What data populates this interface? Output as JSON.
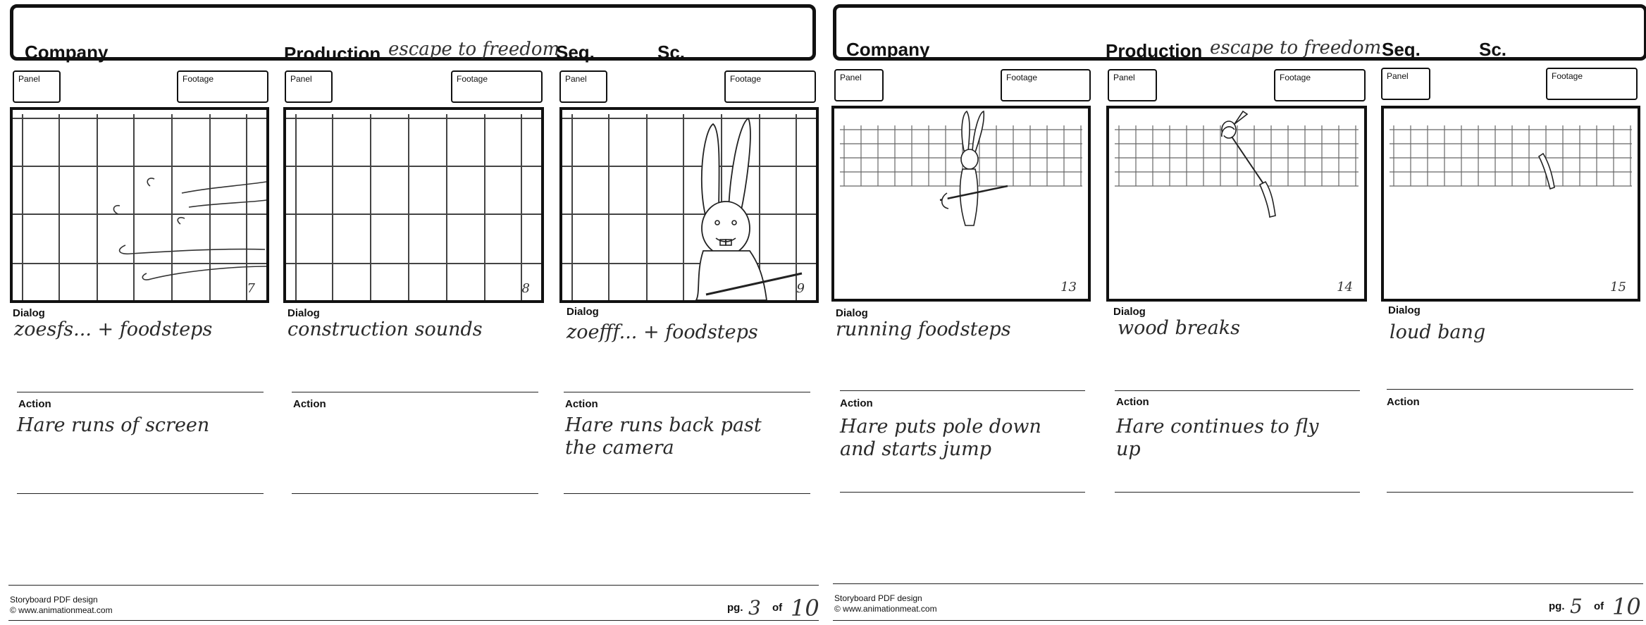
{
  "labels": {
    "company": "Company",
    "production": "Production",
    "seq": "Seq.",
    "sc": "Sc.",
    "panel": "Panel",
    "footage": "Footage",
    "dialog": "Dialog",
    "action": "Action",
    "pg": "pg.",
    "of": "of",
    "credit_line1": "Storyboard PDF design",
    "credit_line2": "© www.animationmeat.com"
  },
  "production_title": "escape to freedom",
  "sheets": [
    {
      "page": "3",
      "total": "10",
      "panels": [
        {
          "number": "7",
          "dialog": "zoesfs... + foodsteps",
          "action": "Hare runs of screen",
          "scene": "motion-swirls"
        },
        {
          "number": "8",
          "dialog": "construction sounds",
          "action": "",
          "scene": "empty-grid"
        },
        {
          "number": "9",
          "dialog": "zoefff... + foodsteps",
          "action": "Hare runs back past\nthe camera",
          "scene": "hare-closeup"
        }
      ]
    },
    {
      "page": "5",
      "total": "10",
      "panels": [
        {
          "number": "13",
          "dialog": "running foodsteps",
          "action": "Hare puts pole down\nand starts jump",
          "scene": "hare-pole"
        },
        {
          "number": "14",
          "dialog": "wood breaks",
          "action": "Hare continues to fly\nup",
          "scene": "pole-break"
        },
        {
          "number": "15",
          "dialog": "loud bang",
          "action": "",
          "scene": "pole-piece"
        }
      ]
    }
  ]
}
